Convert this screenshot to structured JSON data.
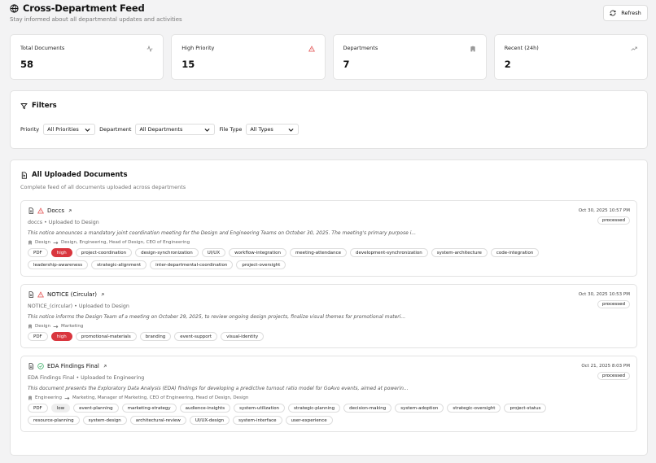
{
  "header": {
    "title": "Cross-Department Feed",
    "subtitle": "Stay informed about all departmental updates and activities",
    "refresh_label": "Refresh"
  },
  "stats": [
    {
      "label": "Total Documents",
      "value": "58",
      "icon": "activity-icon"
    },
    {
      "label": "High Priority",
      "value": "15",
      "icon": "alert-triangle-icon"
    },
    {
      "label": "Departments",
      "value": "7",
      "icon": "building-icon"
    },
    {
      "label": "Recent (24h)",
      "value": "2",
      "icon": "trending-up-icon"
    }
  ],
  "filters": {
    "title": "Filters",
    "priority_label": "Priority",
    "priority_value": "All Priorities",
    "department_label": "Department",
    "department_value": "All Departments",
    "filetype_label": "File Type",
    "filetype_value": "All Types"
  },
  "documents_section": {
    "title": "All Uploaded Documents",
    "subtitle": "Complete feed of all documents uploaded across departments"
  },
  "documents": [
    {
      "title": "Doccs",
      "meta": "doccs • Uploaded to Design",
      "description": "This notice announces a mandatory joint coordination meeting for the Design and Engineering Teams on October 30, 2025. The meeting's primary purpose i...",
      "from": "Design",
      "to": "Design, Engineering, Head of Design, CEO of Engineering",
      "date": "Oct 30, 2025 10:57 PM",
      "status": "processed",
      "status_icon": "alert-triangle-icon",
      "tags": [
        "PDF",
        "high",
        "project-coordination",
        "design-synchronization",
        "UI/UX",
        "workflow-integration",
        "meeting-attendance",
        "development-synchronization",
        "system-architecture",
        "code-integration",
        "leadership-awareness",
        "strategic-alignment",
        "inter-departmental-coordination",
        "project-oversight"
      ]
    },
    {
      "title": "NOTICE (Circular)",
      "meta": "NOTICE_(circular) • Uploaded to Design",
      "description": "This notice informs the Design Team of a meeting on October 29, 2025, to review ongoing design projects, finalize visual themes for promotional materi...",
      "from": "Design",
      "to": "Marketing",
      "date": "Oct 30, 2025 10:53 PM",
      "status": "processed",
      "status_icon": "alert-triangle-icon",
      "tags": [
        "PDF",
        "high",
        "promotional-materials",
        "branding",
        "event-support",
        "visual-identity"
      ]
    },
    {
      "title": "EDA Findings Final",
      "meta": "EDA Findings Final • Uploaded to Engineering",
      "description": "This document presents the Exploratory Data Analysis (EDA) findings for developing a predictive turnout ratio model for GoAvo events, aimed at powerin...",
      "from": "Engineering",
      "to": "Marketing, Manager of Marketing, CEO of Engineering, Head of Design, Design",
      "date": "Oct 21, 2025 8:03 PM",
      "status": "processed",
      "status_icon": "check-circle-icon",
      "tags": [
        "PDF",
        "low",
        "event-planning",
        "marketing-strategy",
        "audience-insights",
        "system-utilization",
        "strategic-planning",
        "decision-making",
        "system-adoption",
        "strategic-oversight",
        "project-status",
        "resource-planning",
        "system-design",
        "architectural-review",
        "UI/UX-design",
        "system-interface",
        "user-experience"
      ]
    }
  ],
  "colors": {
    "high": "#d9363e",
    "alert": "#e04848",
    "ok": "#2eaa5c"
  }
}
